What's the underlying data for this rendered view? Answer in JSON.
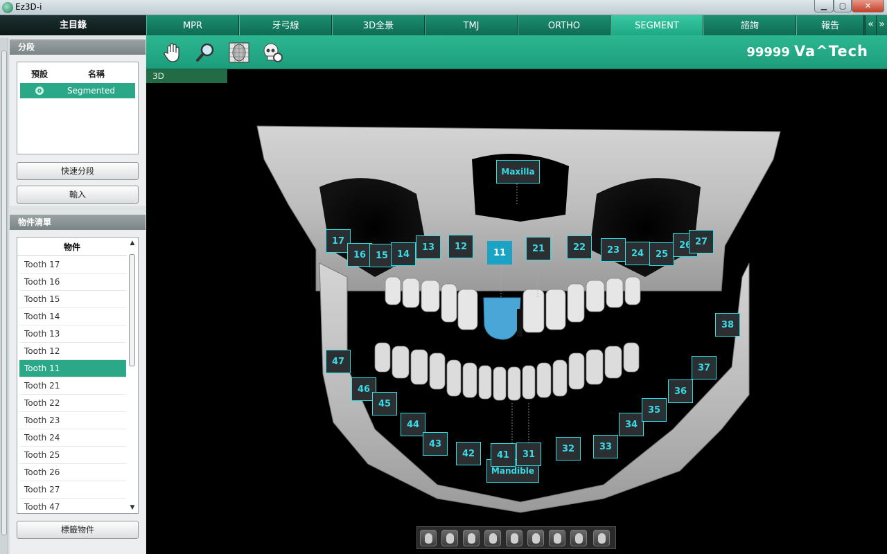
{
  "window": {
    "title": "Ez3D-i"
  },
  "left_panel": {
    "main_menu_label": "主目錄",
    "segment_section": {
      "title": "分段",
      "col_default": "預設",
      "col_name": "名稱",
      "rows": [
        {
          "name": "Segmented",
          "default": true
        }
      ],
      "quick_segment_button": "快速分段",
      "import_button": "輸入"
    },
    "object_section": {
      "title": "物件清單",
      "column_header": "物件",
      "items": [
        "Tooth 17",
        "Tooth 16",
        "Tooth 15",
        "Tooth 14",
        "Tooth 13",
        "Tooth 12",
        "Tooth 11",
        "Tooth 21",
        "Tooth 22",
        "Tooth 23",
        "Tooth 24",
        "Tooth 25",
        "Tooth 26",
        "Tooth 27",
        "Tooth 47"
      ],
      "selected": "Tooth 11",
      "label_button": "標籤物件"
    }
  },
  "tabs": [
    {
      "label": "MPR",
      "active": false
    },
    {
      "label": "牙弓線",
      "active": false
    },
    {
      "label": "3D全景",
      "active": false
    },
    {
      "label": "TMJ",
      "active": false
    },
    {
      "label": "ORTHO",
      "active": false
    },
    {
      "label": "SEGMENT",
      "active": true
    },
    {
      "label": "諮詢",
      "active": false
    },
    {
      "label": "報告",
      "active": false
    }
  ],
  "toolbar": {
    "tools": [
      "pan-hand-icon",
      "zoom-magnifier-icon",
      "face-grid-icon",
      "skull-settings-icon"
    ],
    "patient_id": "99999",
    "brand": "Va^Tech"
  },
  "viewport": {
    "label": "3D",
    "structure_labels": {
      "maxilla": "Maxilla",
      "mandible": "Mandible"
    },
    "upper_teeth": [
      "17",
      "16",
      "15",
      "14",
      "13",
      "12",
      "11",
      "21",
      "22",
      "23",
      "24",
      "25",
      "26",
      "27"
    ],
    "lower_teeth": [
      "47",
      "46",
      "45",
      "44",
      "43",
      "42",
      "41",
      "31",
      "32",
      "33",
      "34",
      "35",
      "36",
      "37",
      "38"
    ],
    "selected_tooth": "11",
    "selected_color": "#1aa3c4"
  },
  "view_buttons": [
    "view-front-icon",
    "view-left-icon",
    "view-right-icon",
    "view-left-oblique-icon",
    "view-right-oblique-icon",
    "view-back-icon",
    "view-top-icon",
    "view-bottom-icon",
    "view-rotate-icon"
  ]
}
